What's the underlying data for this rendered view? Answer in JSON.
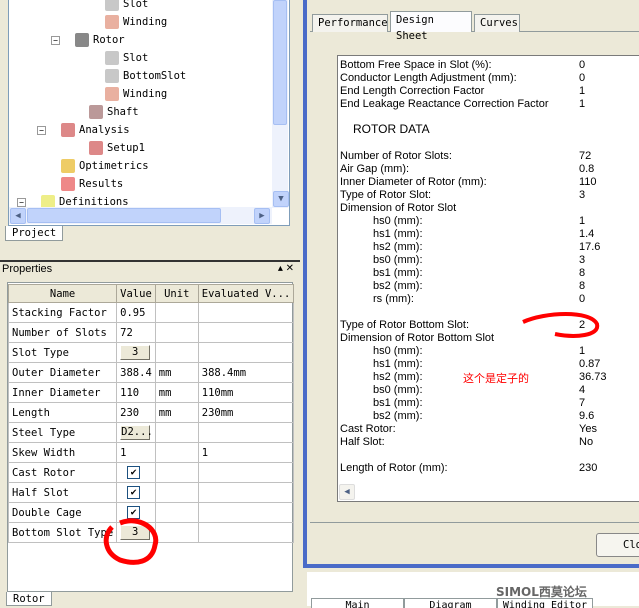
{
  "tree": {
    "items": [
      {
        "label": "Slot",
        "icon": "slot-icon"
      },
      {
        "label": "Winding",
        "icon": "winding-icon"
      },
      {
        "label": "Rotor",
        "icon": "rotor-icon"
      },
      {
        "label": "Slot",
        "icon": "slot-icon"
      },
      {
        "label": "BottomSlot",
        "icon": "slot-icon"
      },
      {
        "label": "Winding",
        "icon": "winding-icon"
      },
      {
        "label": "Shaft",
        "icon": "shaft-icon"
      },
      {
        "label": "Analysis",
        "icon": "analysis-icon"
      },
      {
        "label": "Setup1",
        "icon": "setup-icon"
      },
      {
        "label": "Optimetrics",
        "icon": "optimetrics-icon"
      },
      {
        "label": "Results",
        "icon": "results-icon"
      },
      {
        "label": "Definitions",
        "icon": "folder-icon"
      }
    ],
    "tab": "Project"
  },
  "properties": {
    "title": "Properties",
    "tab": "Rotor",
    "columns": [
      "Name",
      "Value",
      "Unit",
      "Evaluated V..."
    ],
    "rows": [
      {
        "name": "Stacking Factor",
        "value": "0.95",
        "unit": "",
        "eval": ""
      },
      {
        "name": "Number of Slots",
        "value": "72",
        "unit": "",
        "eval": ""
      },
      {
        "name": "Slot Type",
        "button": "3",
        "unit": "",
        "eval": ""
      },
      {
        "name": "Outer Diameter",
        "value": "388.4",
        "unit": "mm",
        "eval": "388.4mm"
      },
      {
        "name": "Inner Diameter",
        "value": "110",
        "unit": "mm",
        "eval": "110mm"
      },
      {
        "name": "Length",
        "value": "230",
        "unit": "mm",
        "eval": "230mm"
      },
      {
        "name": "Steel Type",
        "button": "D2...",
        "unit": "",
        "eval": ""
      },
      {
        "name": "Skew Width",
        "value": "1",
        "unit": "",
        "eval": "1"
      },
      {
        "name": "Cast Rotor",
        "check": "✔",
        "unit": "",
        "eval": ""
      },
      {
        "name": "Half Slot",
        "check": "✔",
        "unit": "",
        "eval": ""
      },
      {
        "name": "Double Cage",
        "check": "✔",
        "unit": "",
        "eval": ""
      },
      {
        "name": "Bottom Slot Type",
        "button": "3",
        "unit": "",
        "eval": ""
      }
    ]
  },
  "dialog": {
    "tabs": [
      "Performance",
      "Design Sheet",
      "Curves"
    ],
    "active_tab": "Design Sheet",
    "close": "Clo",
    "lines": [
      {
        "l": "Bottom Free Space in Slot (%):",
        "v": "0"
      },
      {
        "l": "Conductor Length Adjustment (mm):",
        "v": "0"
      },
      {
        "l": "End Length Correction Factor",
        "v": "1"
      },
      {
        "l": "End Leakage Reactance Correction Factor",
        "v": "1"
      },
      {
        "l": "ROTOR DATA",
        "v": ""
      },
      {
        "l": "Number of Rotor Slots:",
        "v": "72"
      },
      {
        "l": "Air Gap (mm):",
        "v": "0.8"
      },
      {
        "l": "Inner Diameter of Rotor (mm):",
        "v": "110"
      },
      {
        "l": "Type of Rotor Slot:",
        "v": "3"
      },
      {
        "l": "Dimension of Rotor Slot",
        "v": ""
      },
      {
        "l": "hs0 (mm):",
        "v": "1"
      },
      {
        "l": "hs1 (mm):",
        "v": "1.4"
      },
      {
        "l": "hs2 (mm):",
        "v": "17.6"
      },
      {
        "l": "bs0 (mm):",
        "v": "3"
      },
      {
        "l": "bs1 (mm):",
        "v": "8"
      },
      {
        "l": "bs2 (mm):",
        "v": "8"
      },
      {
        "l": "rs (mm):",
        "v": "0"
      },
      {
        "l": "Type of Rotor Bottom Slot:",
        "v": "2"
      },
      {
        "l": "Dimension of Rotor Bottom Slot",
        "v": ""
      },
      {
        "l": "hs0 (mm):",
        "v": "1"
      },
      {
        "l": "hs1 (mm):",
        "v": "0.87"
      },
      {
        "l": "hs2 (mm):",
        "v": "36.73"
      },
      {
        "l": "bs0 (mm):",
        "v": "4"
      },
      {
        "l": "bs1 (mm):",
        "v": "7"
      },
      {
        "l": "bs2 (mm):",
        "v": "9.6"
      },
      {
        "l": "Cast Rotor:",
        "v": "Yes"
      },
      {
        "l": "Half Slot:",
        "v": "No"
      },
      {
        "l": "Length of Rotor (mm):",
        "v": "230"
      }
    ],
    "annotation": "这个是定子的"
  },
  "bottom_tabs": [
    "Main",
    "Diagram",
    "Winding Editor"
  ],
  "watermark": "SIMOL西莫论坛",
  "colors": {
    "annotation": "#ff0000",
    "titlebar": "#4a6bc8"
  }
}
